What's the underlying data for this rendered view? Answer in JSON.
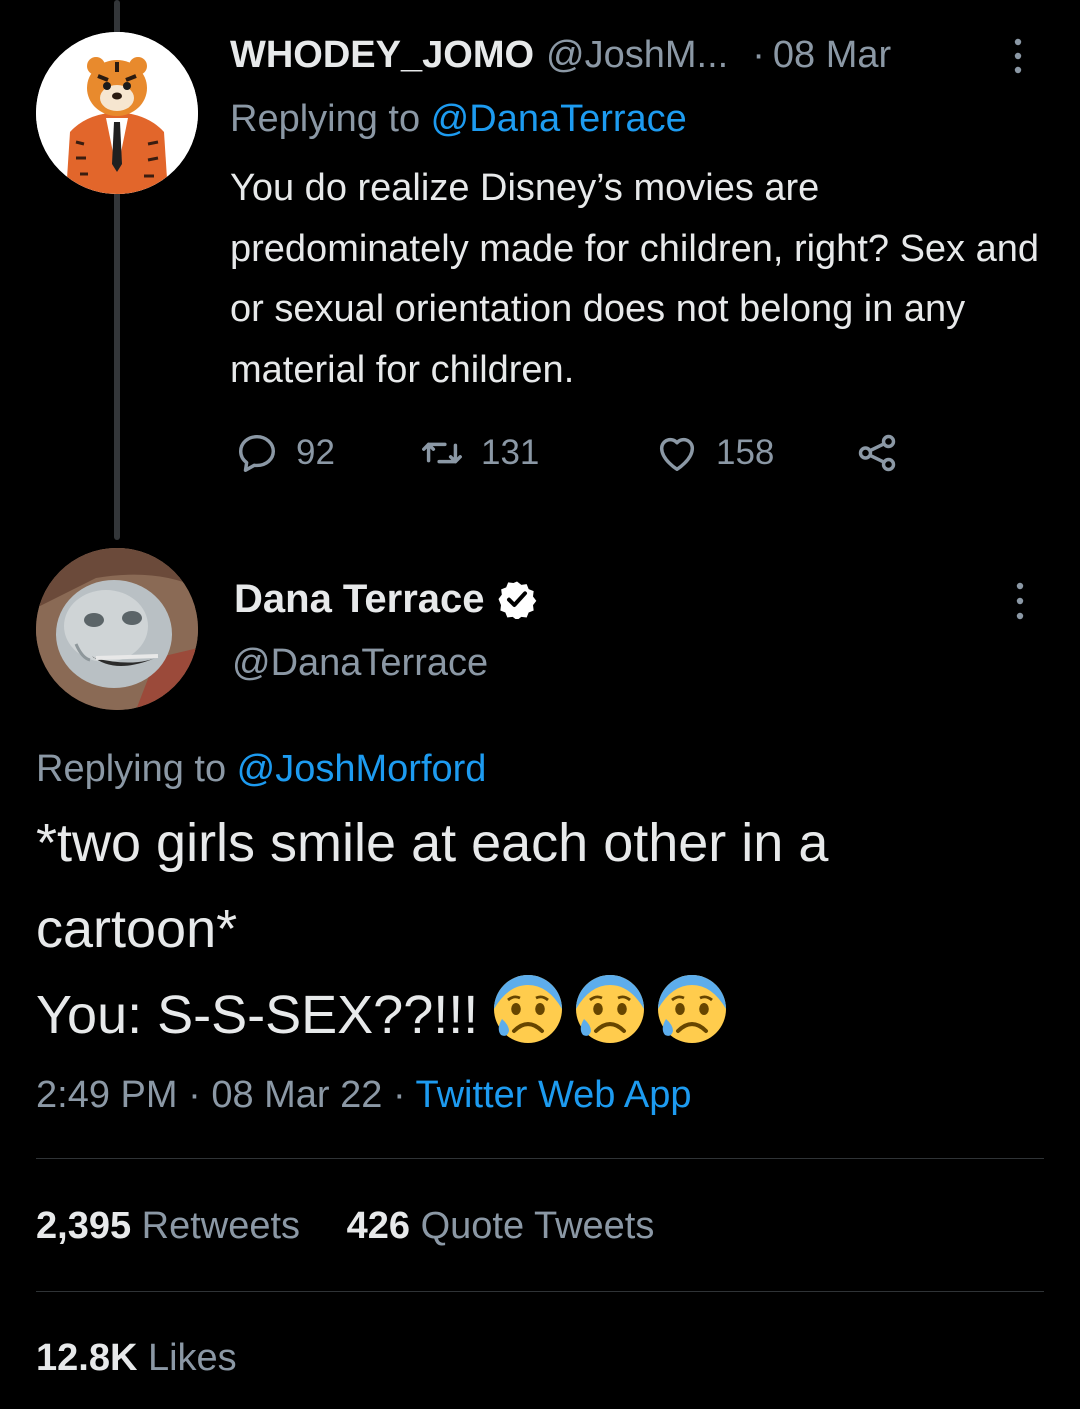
{
  "colors": {
    "background": "#000000",
    "text_primary": "#e7e9ea",
    "text_secondary": "#8b98a5",
    "link": "#1d9bf0",
    "divider": "#2f3336"
  },
  "reply_tweet": {
    "display_name": "WHODEY_JOMO",
    "handle": "@JoshM...",
    "separator": "·",
    "time": "08 Mar",
    "replying_prefix": "Replying to ",
    "replying_to": "@DanaTerrace",
    "text": "You do realize Disney’s movies are predominately made for children, right? Sex and or sexual orientation does not belong in any material for children.",
    "avatar_icon": "tiger-mascot-avatar",
    "counts": {
      "replies": "92",
      "retweets": "131",
      "likes": "158"
    }
  },
  "main_tweet": {
    "display_name": "Dana Terrace",
    "verified_icon": "verified-badge-icon",
    "handle": "@DanaTerrace",
    "avatar_icon": "medieval-face-avatar",
    "replying_prefix": "Replying to ",
    "replying_to": "@JoshMorford",
    "text_line1": "*two girls smile at each other in a",
    "text_line2": "cartoon*",
    "text_line3": "You: S-S-SEX??!!!",
    "emoji": "anxious-face-with-sweat",
    "emoji_count": 3,
    "time": "2:49 PM",
    "separator": "·",
    "date": "08 Mar 22",
    "source": "Twitter Web App",
    "retweets_count": "2,395",
    "retweets_label": "Retweets",
    "quotes_count": "426",
    "quotes_label": "Quote Tweets",
    "likes_count": "12.8K",
    "likes_label": "Likes"
  }
}
